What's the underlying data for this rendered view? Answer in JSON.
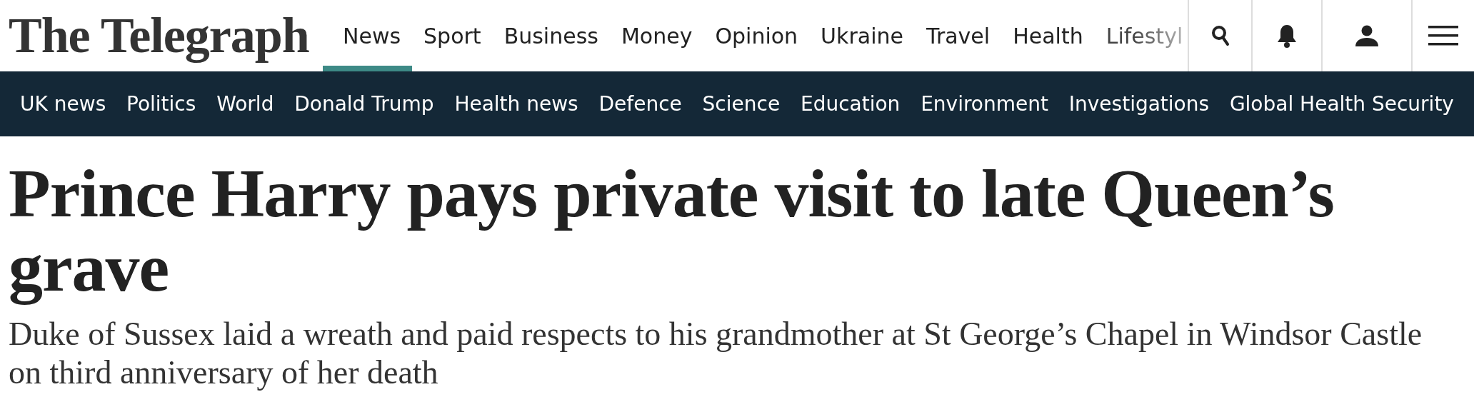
{
  "logo": "The Telegraph",
  "main_nav": [
    {
      "label": "News",
      "selected": true
    },
    {
      "label": "Sport",
      "selected": false
    },
    {
      "label": "Business",
      "selected": false
    },
    {
      "label": "Money",
      "selected": false
    },
    {
      "label": "Opinion",
      "selected": false
    },
    {
      "label": "Ukraine",
      "selected": false
    },
    {
      "label": "Travel",
      "selected": false
    },
    {
      "label": "Health",
      "selected": false
    },
    {
      "label": "Lifestyl",
      "selected": false,
      "faded": true
    }
  ],
  "toolbar": [
    {
      "kind": "search"
    },
    {
      "kind": "notifications"
    },
    {
      "kind": "account"
    },
    {
      "kind": "menu"
    }
  ],
  "sub_nav": [
    "UK news",
    "Politics",
    "World",
    "Donald Trump",
    "Health news",
    "Defence",
    "Science",
    "Education",
    "Environment",
    "Investigations",
    "Global Health Security"
  ],
  "article": {
    "headline": "Prince Harry pays private visit to late Queen’s grave",
    "standfirst": "Duke of Sussex laid a wreath and paid respects to his grandmother at St George’s Chapel in Windsor Castle on third anniversary of her death"
  }
}
